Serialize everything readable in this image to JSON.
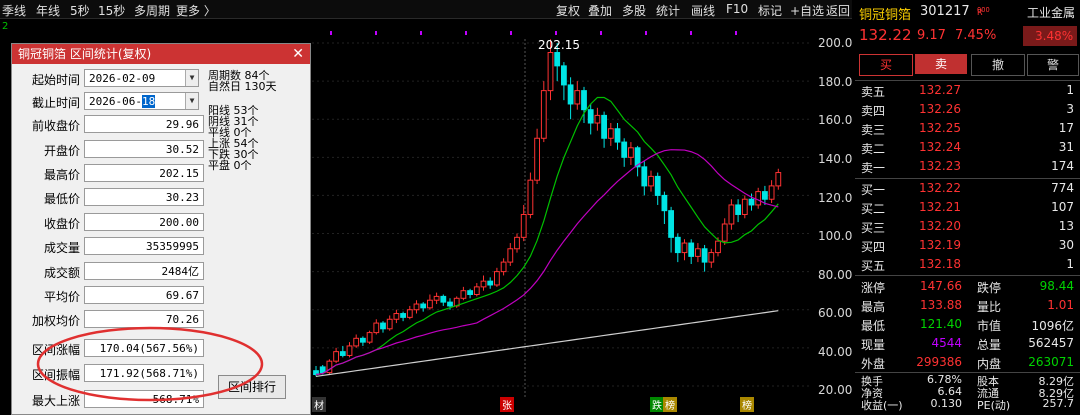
{
  "toolbar": {
    "left": [
      "季线",
      "年线",
      "5秒",
      "15秒",
      "多周期",
      "更多 〉"
    ],
    "right": [
      "复权",
      "叠加",
      "多股",
      "统计",
      "画线",
      "F10",
      "标记",
      "+自选",
      "返回"
    ]
  },
  "indicator_top": "2",
  "y_axis": [
    "200.0",
    "180.0",
    "160.0",
    "140.0",
    "120.0",
    "100.0",
    "80.00",
    "60.00",
    "40.00",
    "20.00"
  ],
  "high_marker": "202.15",
  "bottom_markers": {
    "m1": "材",
    "m2": "张",
    "m3": "跌",
    "m4": "榜",
    "m5": "榜"
  },
  "colors": {
    "up": "#ff3232",
    "down": "#00e5e5",
    "ma_short": "#00c000",
    "ma_mid": "#c000c0",
    "ma_long": "#d0d0d0",
    "accent": "#cc3333"
  },
  "candles": [
    [
      28,
      26,
      30.5,
      25
    ],
    [
      30,
      27,
      31,
      26
    ],
    [
      27,
      33,
      34,
      26
    ],
    [
      33,
      38,
      40,
      32
    ],
    [
      38,
      36,
      41,
      35
    ],
    [
      36,
      41,
      43,
      35
    ],
    [
      41,
      45,
      47,
      40
    ],
    [
      45,
      43,
      46,
      41
    ],
    [
      43,
      48,
      49,
      42
    ],
    [
      48,
      53,
      55,
      47
    ],
    [
      53,
      50,
      54,
      48
    ],
    [
      50,
      55,
      57,
      49
    ],
    [
      55,
      58,
      60,
      53
    ],
    [
      58,
      56,
      59,
      54
    ],
    [
      56,
      60,
      62,
      55
    ],
    [
      60,
      63,
      65,
      58
    ],
    [
      63,
      61,
      64,
      59
    ],
    [
      61,
      65,
      68,
      60
    ],
    [
      65,
      67,
      69,
      63
    ],
    [
      67,
      64,
      68,
      62
    ],
    [
      64,
      62,
      66,
      60
    ],
    [
      62,
      66,
      67,
      61
    ],
    [
      66,
      70,
      72,
      65
    ],
    [
      70,
      68,
      71,
      66
    ],
    [
      68,
      72,
      74,
      67
    ],
    [
      72,
      75,
      78,
      70
    ],
    [
      75,
      73,
      77,
      71
    ],
    [
      73,
      80,
      82,
      72
    ],
    [
      80,
      85,
      87,
      78
    ],
    [
      85,
      92,
      95,
      83
    ],
    [
      92,
      98,
      100,
      90
    ],
    [
      98,
      110,
      115,
      96
    ],
    [
      110,
      128,
      132,
      108
    ],
    [
      128,
      150,
      155,
      126
    ],
    [
      150,
      175,
      180,
      148
    ],
    [
      175,
      195,
      202,
      170
    ],
    [
      195,
      188,
      200,
      180
    ],
    [
      188,
      178,
      190,
      170
    ],
    [
      178,
      168,
      182,
      160
    ],
    [
      168,
      175,
      180,
      165
    ],
    [
      175,
      165,
      177,
      158
    ],
    [
      165,
      158,
      168,
      152
    ],
    [
      158,
      162,
      166,
      154
    ],
    [
      162,
      150,
      164,
      145
    ],
    [
      150,
      155,
      158,
      146
    ],
    [
      155,
      148,
      158,
      144
    ],
    [
      148,
      140,
      150,
      135
    ],
    [
      140,
      145,
      148,
      136
    ],
    [
      145,
      135,
      146,
      130
    ],
    [
      135,
      125,
      138,
      120
    ],
    [
      125,
      130,
      133,
      122
    ],
    [
      130,
      120,
      132,
      115
    ],
    [
      120,
      112,
      122,
      105
    ],
    [
      112,
      98,
      114,
      90
    ],
    [
      98,
      90,
      100,
      85
    ],
    [
      90,
      95,
      97,
      86
    ],
    [
      95,
      88,
      97,
      84
    ],
    [
      88,
      92,
      95,
      85
    ],
    [
      92,
      85,
      94,
      80
    ],
    [
      85,
      90,
      92,
      82
    ],
    [
      90,
      96,
      98,
      88
    ],
    [
      96,
      105,
      108,
      94
    ],
    [
      105,
      115,
      118,
      102
    ],
    [
      115,
      110,
      118,
      106
    ],
    [
      110,
      118,
      120,
      108
    ],
    [
      118,
      115,
      121,
      112
    ],
    [
      115,
      122,
      124,
      113
    ],
    [
      122,
      118,
      125,
      115
    ],
    [
      118,
      125,
      128,
      116
    ],
    [
      125,
      132,
      134,
      123
    ]
  ],
  "dialog": {
    "title": "铜冠铜箔 区间统计(复权)",
    "start_label": "起始时间",
    "start_value": "2026-02-09",
    "end_label": "截止时间",
    "end_value_prefix": "2026-06-",
    "end_value_sel": "18",
    "rows": [
      {
        "label": "前收盘价",
        "value": "29.96"
      },
      {
        "label": "开盘价",
        "value": "30.52"
      },
      {
        "label": "最高价",
        "value": "202.15"
      },
      {
        "label": "最低价",
        "value": "30.23"
      },
      {
        "label": "收盘价",
        "value": "200.00"
      },
      {
        "label": "成交量",
        "value": "35359995"
      },
      {
        "label": "成交额",
        "value": "2484亿"
      },
      {
        "label": "平均价",
        "value": "69.67"
      },
      {
        "label": "加权均价",
        "value": "70.26"
      },
      {
        "label": "区间涨幅",
        "value": "170.04(567.56%)"
      },
      {
        "label": "区间振幅",
        "value": "171.92(568.71%)"
      },
      {
        "label": "最大上涨",
        "value": "568.71%"
      }
    ],
    "stats": [
      "周期数 84个",
      "自然日 130天",
      "阳线 53个",
      "阴线 31个",
      "平线 0个",
      "上涨 54个",
      "下跌 30个",
      "平盘 0个"
    ],
    "rank_button": "区间排行"
  },
  "panel": {
    "stock_name": "铜冠铜箔",
    "stock_code": "301217",
    "tag": "R",
    "industry": "工业金属",
    "industry_pct": "3.48%",
    "price": "132.22",
    "change": "9.17",
    "change_pct": "7.45%",
    "btn_buy": "买",
    "btn_sell": "卖",
    "btn_cancel": "撤",
    "btn_alert": "警",
    "asks": [
      {
        "label": "卖五",
        "price": "132.27",
        "vol": "1"
      },
      {
        "label": "卖四",
        "price": "132.26",
        "vol": "3"
      },
      {
        "label": "卖三",
        "price": "132.25",
        "vol": "17"
      },
      {
        "label": "卖二",
        "price": "132.24",
        "vol": "31"
      },
      {
        "label": "卖一",
        "price": "132.23",
        "vol": "174"
      }
    ],
    "bids": [
      {
        "label": "买一",
        "price": "132.22",
        "vol": "774"
      },
      {
        "label": "买二",
        "price": "132.21",
        "vol": "107"
      },
      {
        "label": "买三",
        "price": "132.20",
        "vol": "13"
      },
      {
        "label": "买四",
        "price": "132.19",
        "vol": "30"
      },
      {
        "label": "买五",
        "price": "132.18",
        "vol": "1"
      }
    ],
    "stats": [
      {
        "l1": "涨停",
        "v1": "147.66",
        "c1": "red",
        "l2": "跌停",
        "v2": "98.44",
        "c2": "green"
      },
      {
        "l1": "最高",
        "v1": "133.88",
        "c1": "red",
        "l2": "量比",
        "v2": "1.01",
        "c2": "red"
      },
      {
        "l1": "最低",
        "v1": "121.40",
        "c1": "green",
        "l2": "市值",
        "v2": "1096亿",
        "c2": "white"
      },
      {
        "l1": "现量",
        "v1": "4544",
        "c1": "purple",
        "l2": "总量",
        "v2": "562457",
        "c2": "white"
      },
      {
        "l1": "外盘",
        "v1": "299386",
        "c1": "red",
        "l2": "内盘",
        "v2": "263071",
        "c2": "green"
      },
      {
        "l1": "换手",
        "v1": "6.78%",
        "c1": "white",
        "l2": "股本",
        "v2": "8.29亿",
        "c2": "white"
      },
      {
        "l1": "净资",
        "v1": "6.64",
        "c1": "white",
        "l2": "流通",
        "v2": "8.29亿",
        "c2": "white"
      },
      {
        "l1": "收益(一)",
        "v1": "0.130",
        "c1": "white",
        "l2": "PE(动)",
        "v2": "257.7",
        "c2": "white"
      }
    ]
  }
}
